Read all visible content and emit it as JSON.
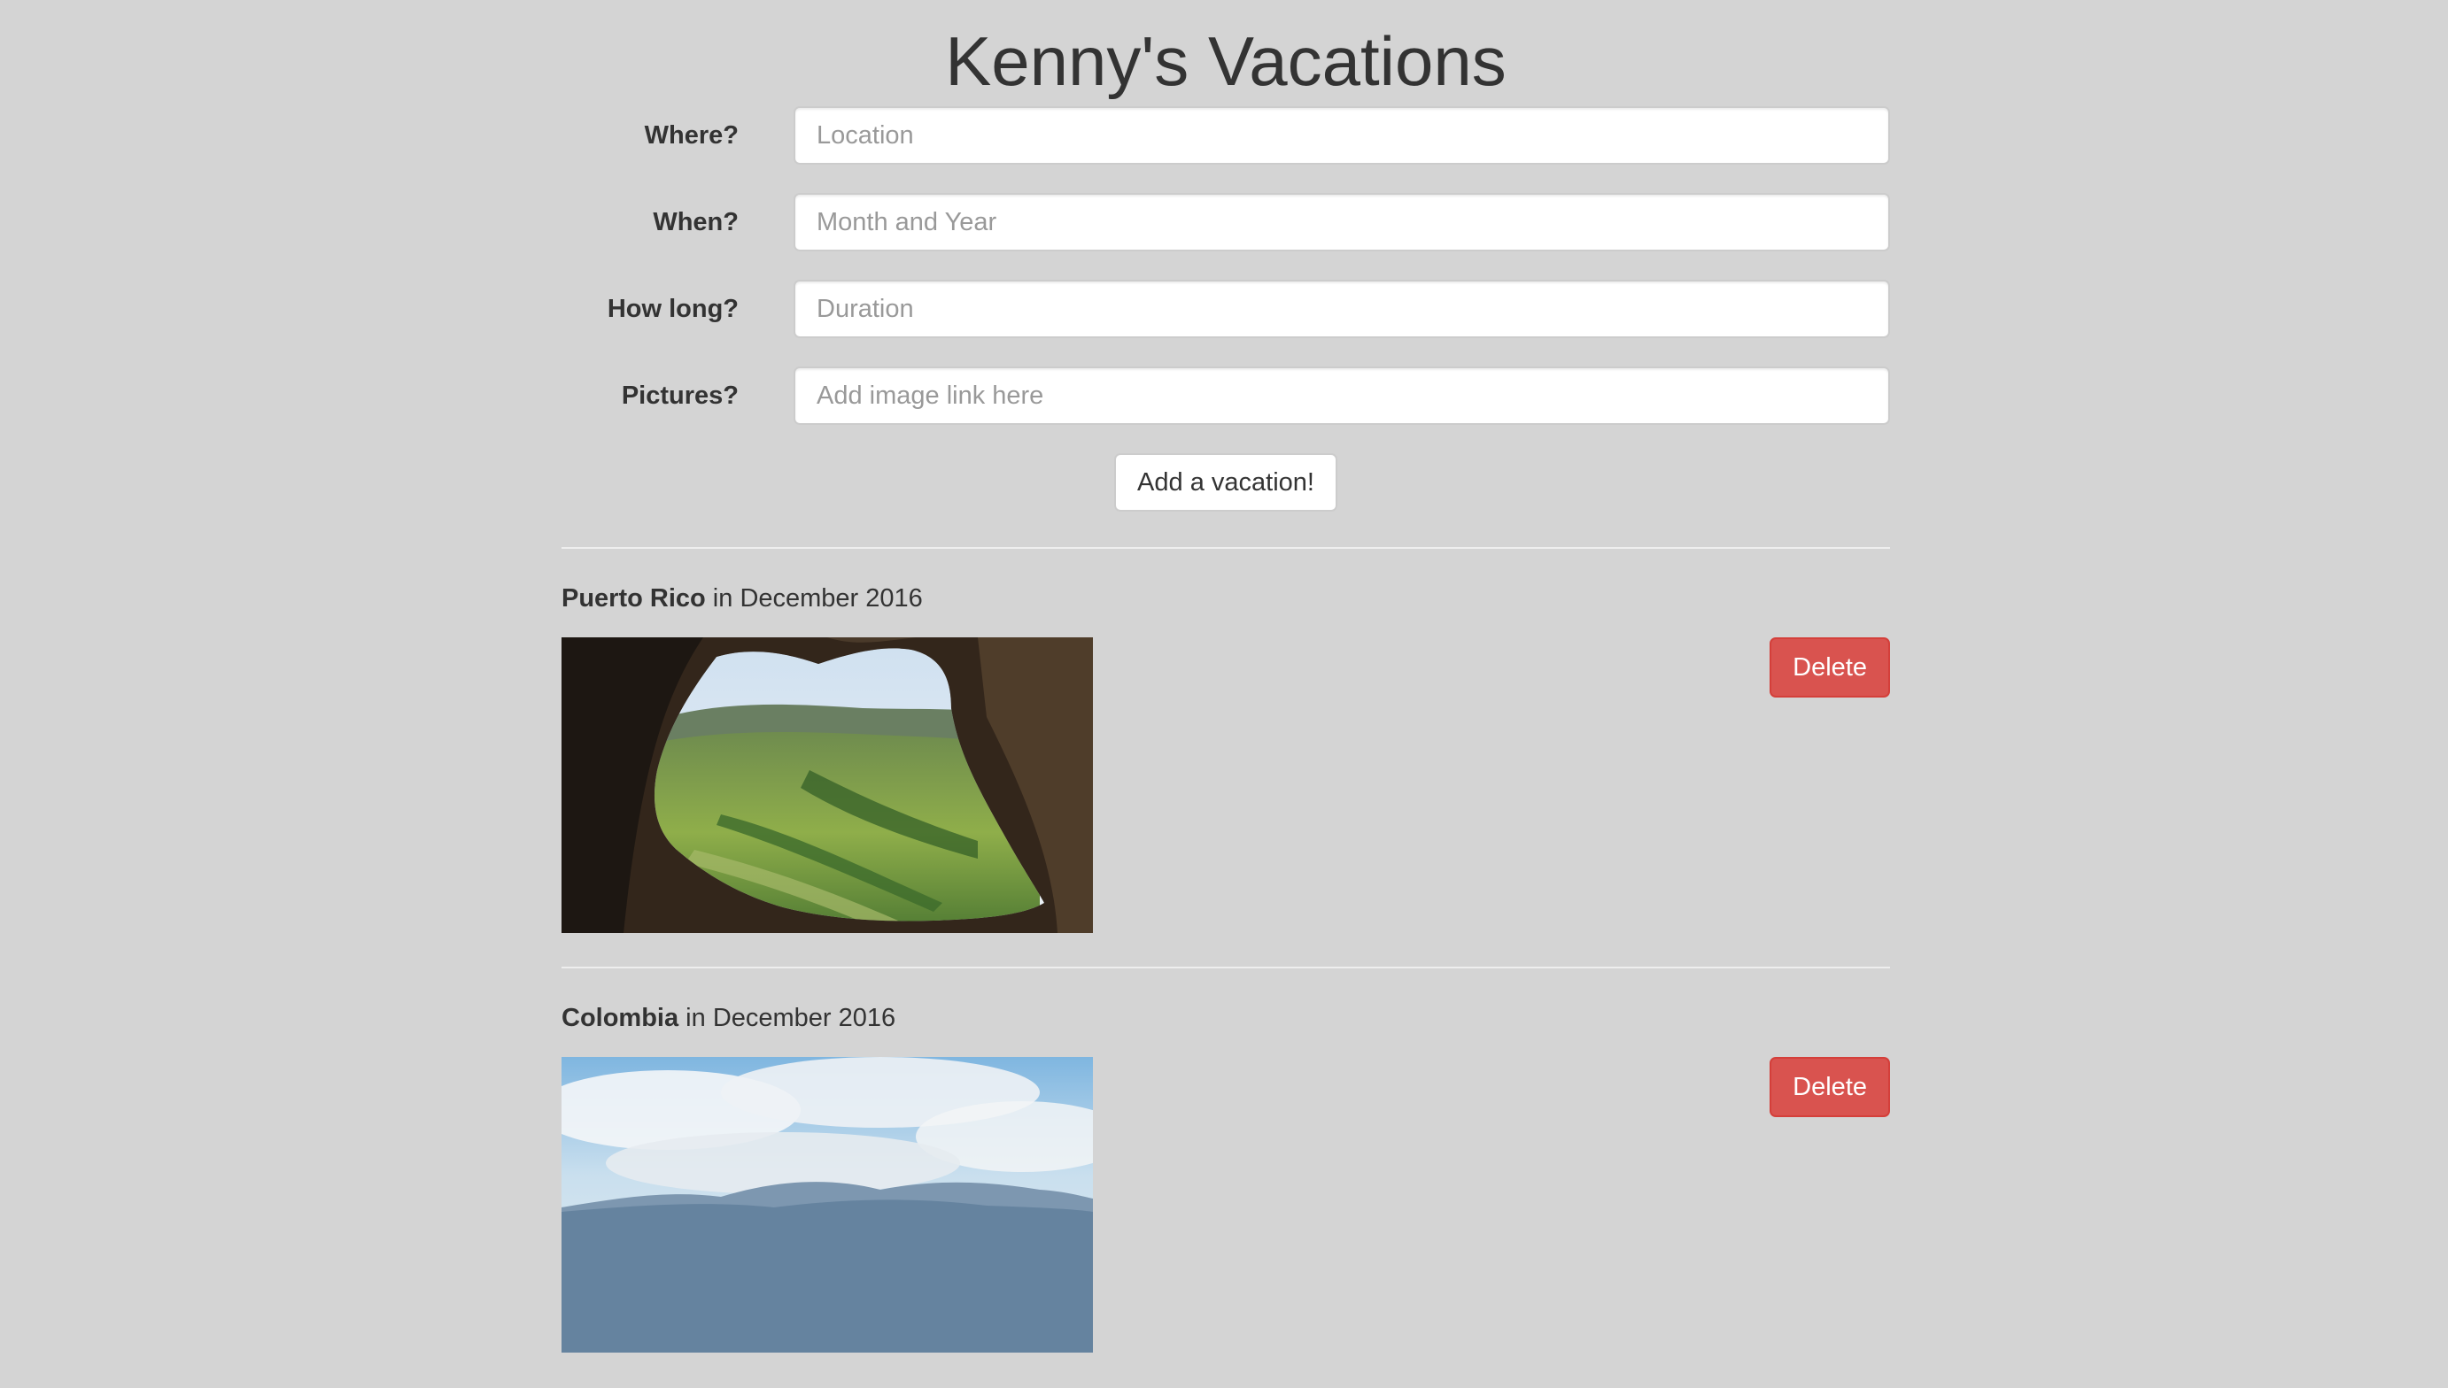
{
  "header": {
    "title": "Kenny's Vacations"
  },
  "form": {
    "fields": [
      {
        "label": "Where?",
        "placeholder": "Location",
        "value": ""
      },
      {
        "label": "When?",
        "placeholder": "Month and Year",
        "value": ""
      },
      {
        "label": "How long?",
        "placeholder": "Duration",
        "value": ""
      },
      {
        "label": "Pictures?",
        "placeholder": "Add image link here",
        "value": ""
      }
    ],
    "submit_label": "Add a vacation!"
  },
  "vacations": [
    {
      "place": "Puerto Rico",
      "connector": " in ",
      "date": "December 2016",
      "delete_label": "Delete"
    },
    {
      "place": "Colombia",
      "connector": " in ",
      "date": "December 2016",
      "delete_label": "Delete"
    }
  ],
  "colors": {
    "background": "#d4d4d4",
    "delete_button": "#d9534f",
    "text": "#333333"
  }
}
